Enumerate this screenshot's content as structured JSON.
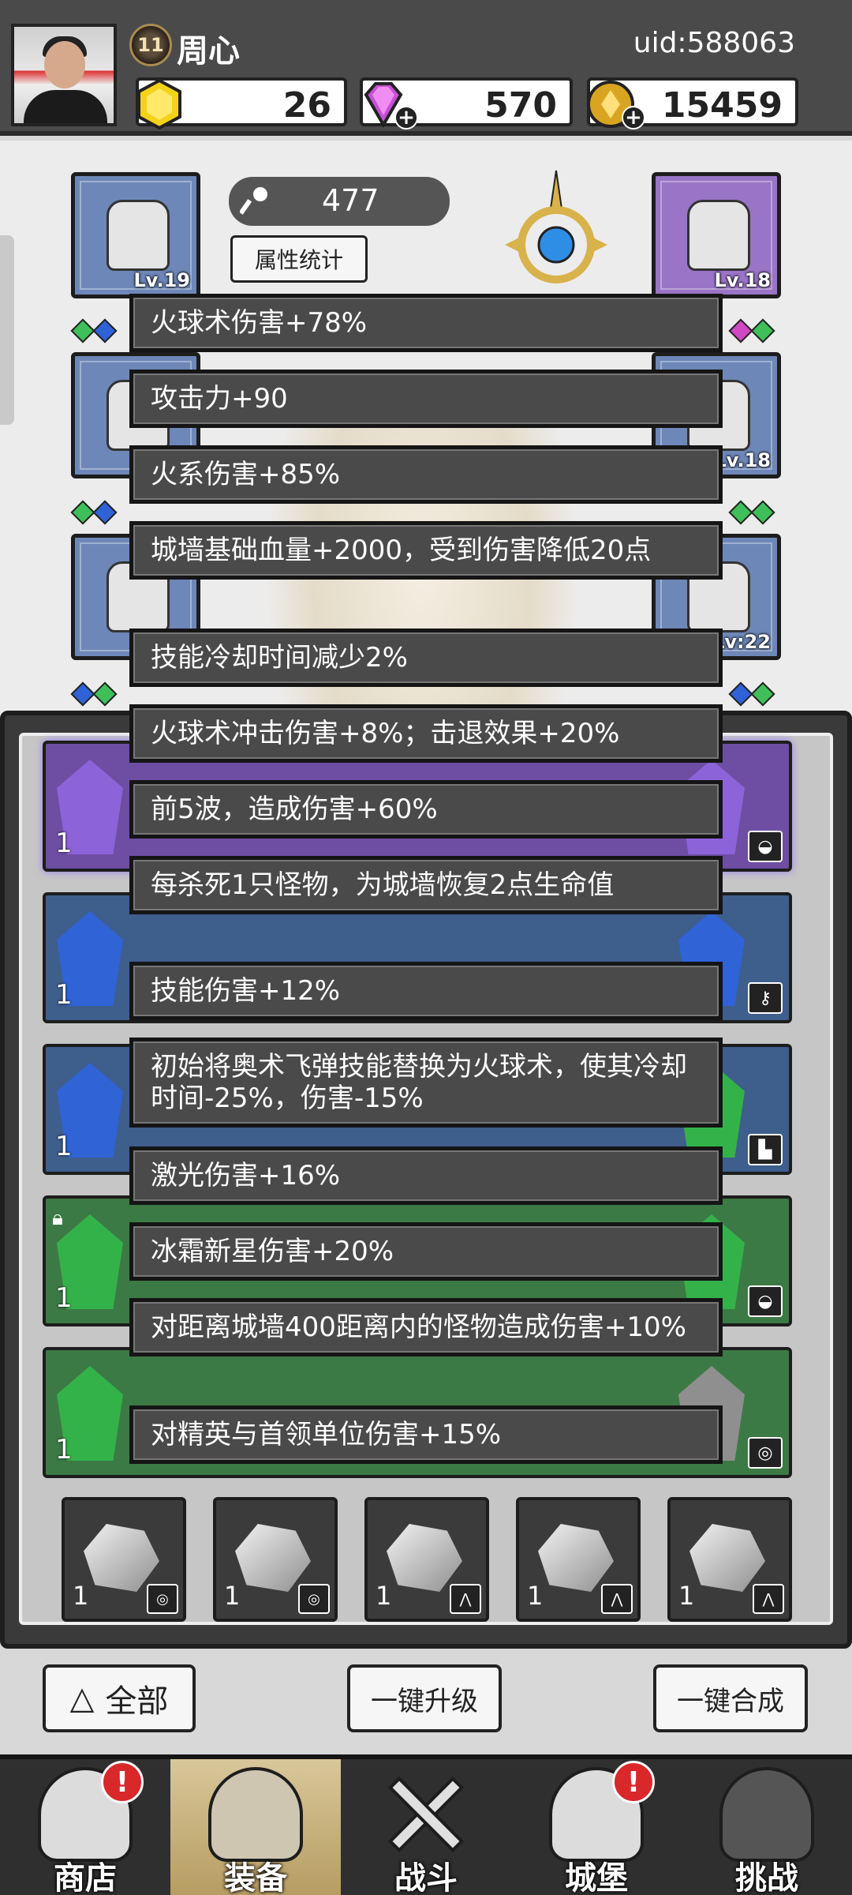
{
  "header": {
    "avatar_icon": "player-avatar-photo",
    "level": "11",
    "player_name": "周心",
    "uid": "uid:588063",
    "resources": [
      {
        "name": "gold-gem",
        "icon": "yellow-hexagon-gem-icon",
        "value": "26",
        "color": "#f3d21b"
      },
      {
        "name": "crystal",
        "icon": "purple-diamond-icon",
        "value": "570",
        "color": "#c64fd6",
        "has_plus": true
      },
      {
        "name": "coin",
        "icon": "gold-coin-icon",
        "value": "15459",
        "color": "#d9a521",
        "has_plus": true
      }
    ]
  },
  "equipment": {
    "power_value": "477",
    "power_icon": "key-icon",
    "stats_button_label": "属性统计",
    "left_slots": [
      {
        "level": "Lv.19",
        "color": "blue",
        "icon": "helmet-icon"
      },
      {
        "level": "",
        "color": "blue",
        "icon": "shoulder-armor-icon"
      },
      {
        "level": "",
        "color": "blue",
        "icon": "boots-icon"
      }
    ],
    "right_slots": [
      {
        "level": "Lv.18",
        "color": "purple",
        "icon": "bracer-icon"
      },
      {
        "level": "Lv.18",
        "color": "blue",
        "icon": "ring-icon"
      },
      {
        "level": "Lv:22",
        "color": "blue",
        "icon": "necklace-icon"
      }
    ]
  },
  "tooltips": [
    "火球术伤害+78%",
    "攻击力+90",
    "火系伤害+85%",
    "城墙基础血量+2000，受到伤害降低20点",
    "技能冷却时间减少2%",
    "火球术冲击伤害+8%；击退效果+20%",
    "前5波，造成伤害+60%",
    "每杀死1只怪物，为城墙恢复2点生命值",
    "技能伤害+12%",
    "初始将奥术飞弹技能替换为火球术，使其冷却时间-25%，伤害-15%",
    "激光伤害+16%",
    "冰霜新星伤害+20%",
    "对距离城墙400距离内的怪物造成伤害+10%",
    "对精英与首领单位伤害+15%"
  ],
  "inventory": {
    "rows": [
      {
        "color": "purple",
        "count": "1",
        "type_icon": "helmet-type-icon",
        "crystal_color": "#8d63d9"
      },
      {
        "color": "blue",
        "count": "1",
        "type_icon": "key-type-icon",
        "crystal_color": "#2f63d6"
      },
      {
        "color": "blue",
        "count": "1",
        "type_icon": "boot-type-icon",
        "crystal_color": "#2f63d6"
      },
      {
        "color": "green",
        "count": "1",
        "type_icon": "helmet-type-icon",
        "crystal_color": "#34b24a",
        "locked": true
      },
      {
        "color": "green",
        "count": "1",
        "type_icon": "ring-type-icon",
        "crystal_color": "#34b24a"
      }
    ],
    "cells": [
      {
        "count": "1",
        "type_icon": "ring-type-icon"
      },
      {
        "count": "1",
        "type_icon": "ring-type-icon"
      },
      {
        "count": "1",
        "type_icon": "shoulder-type-icon"
      },
      {
        "count": "1",
        "type_icon": "shoulder-type-icon"
      },
      {
        "count": "1",
        "type_icon": "shoulder-type-icon"
      }
    ]
  },
  "buttons": {
    "all_label": "全部",
    "upgrade_label": "一键升级",
    "merge_label": "一键合成"
  },
  "nav": [
    {
      "label": "商店",
      "icon": "shop-hut-icon",
      "alert": "!",
      "active": false
    },
    {
      "label": "装备",
      "icon": "backpack-icon",
      "alert": "",
      "active": true
    },
    {
      "label": "战斗",
      "icon": "crossed-swords-icon",
      "alert": "",
      "active": false
    },
    {
      "label": "城堡",
      "icon": "castle-tower-icon",
      "alert": "!",
      "active": false
    },
    {
      "label": "挑战",
      "icon": "locked-shield-icon",
      "alert": "",
      "active": false
    }
  ]
}
